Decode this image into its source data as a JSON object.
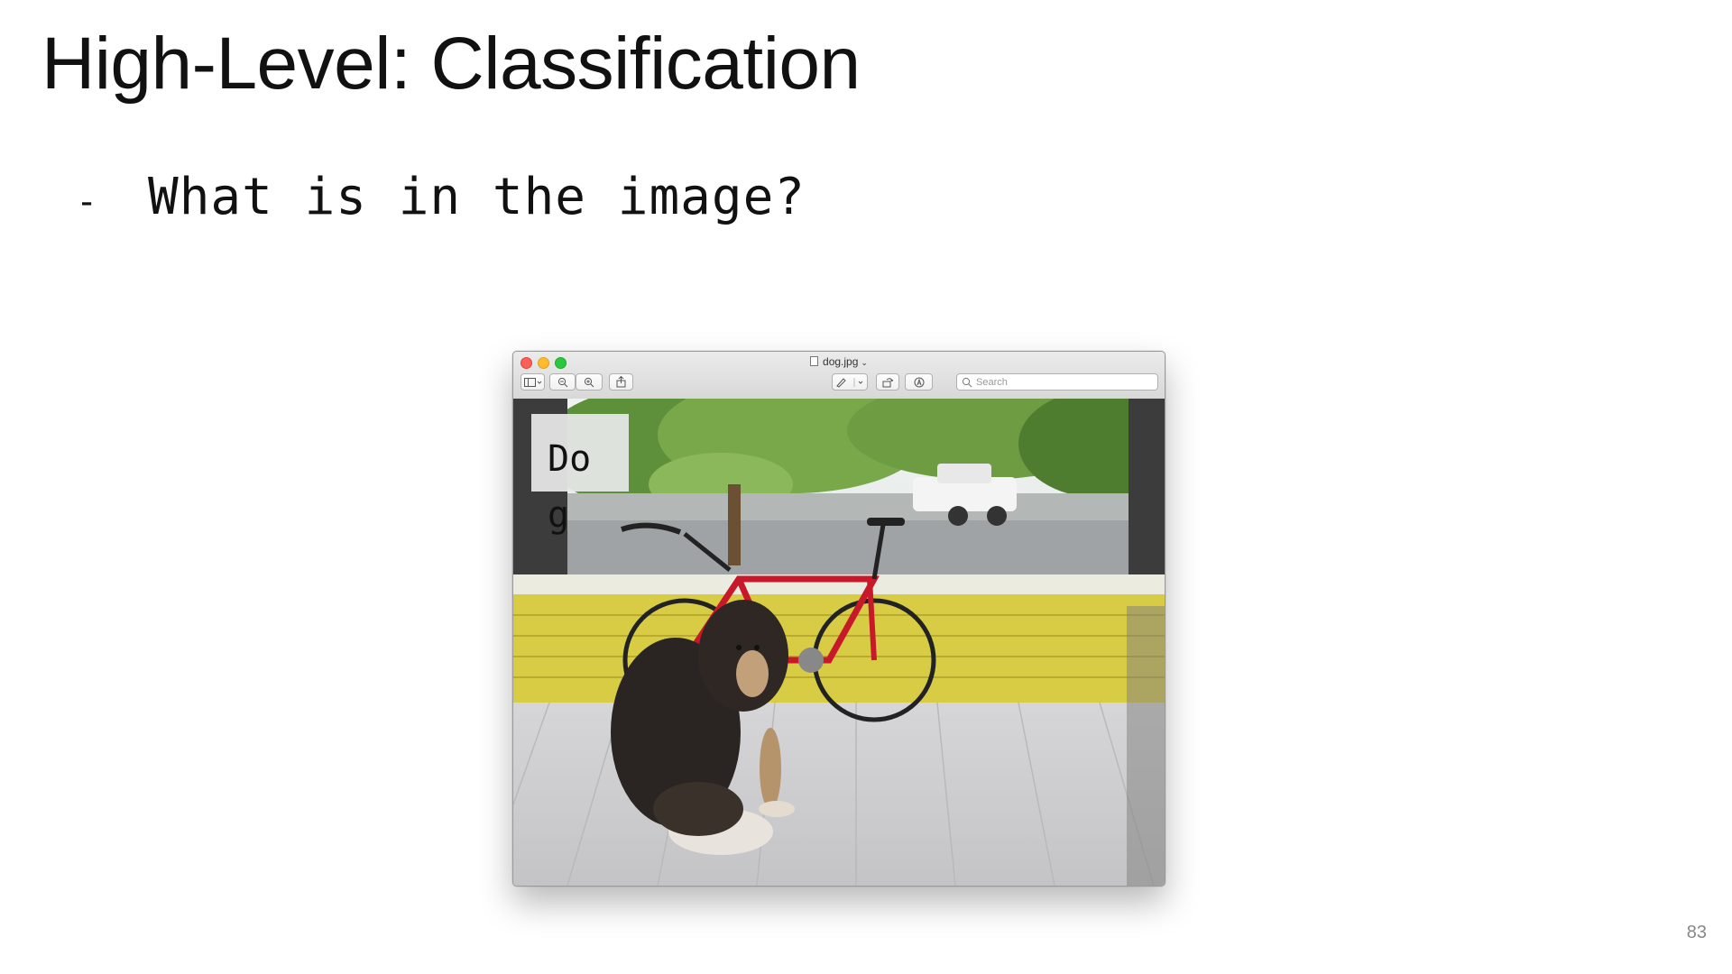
{
  "slide": {
    "title": "High-Level: Classification",
    "bullet_marker": "-",
    "bullet_text": "What is in the image?",
    "page_number": "83"
  },
  "window": {
    "title": "dog.jpg",
    "title_chevron": "chevron-down",
    "search": {
      "placeholder": "Search"
    },
    "toolbar_icons": [
      "sidebar-toggle-icon",
      "zoom-out-icon",
      "zoom-in-icon",
      "share-icon",
      "markup-pen-icon",
      "rotate-icon",
      "annotate-icon",
      "search-icon"
    ],
    "image": {
      "filename": "dog.jpg",
      "classification_label": "Dog"
    }
  },
  "colors": {
    "close": "#fc5f57",
    "minimize": "#fdbc2e",
    "maximize": "#29c840",
    "railing_yellow": "#d8c94a",
    "floor_gray": "#cfcfcf"
  }
}
